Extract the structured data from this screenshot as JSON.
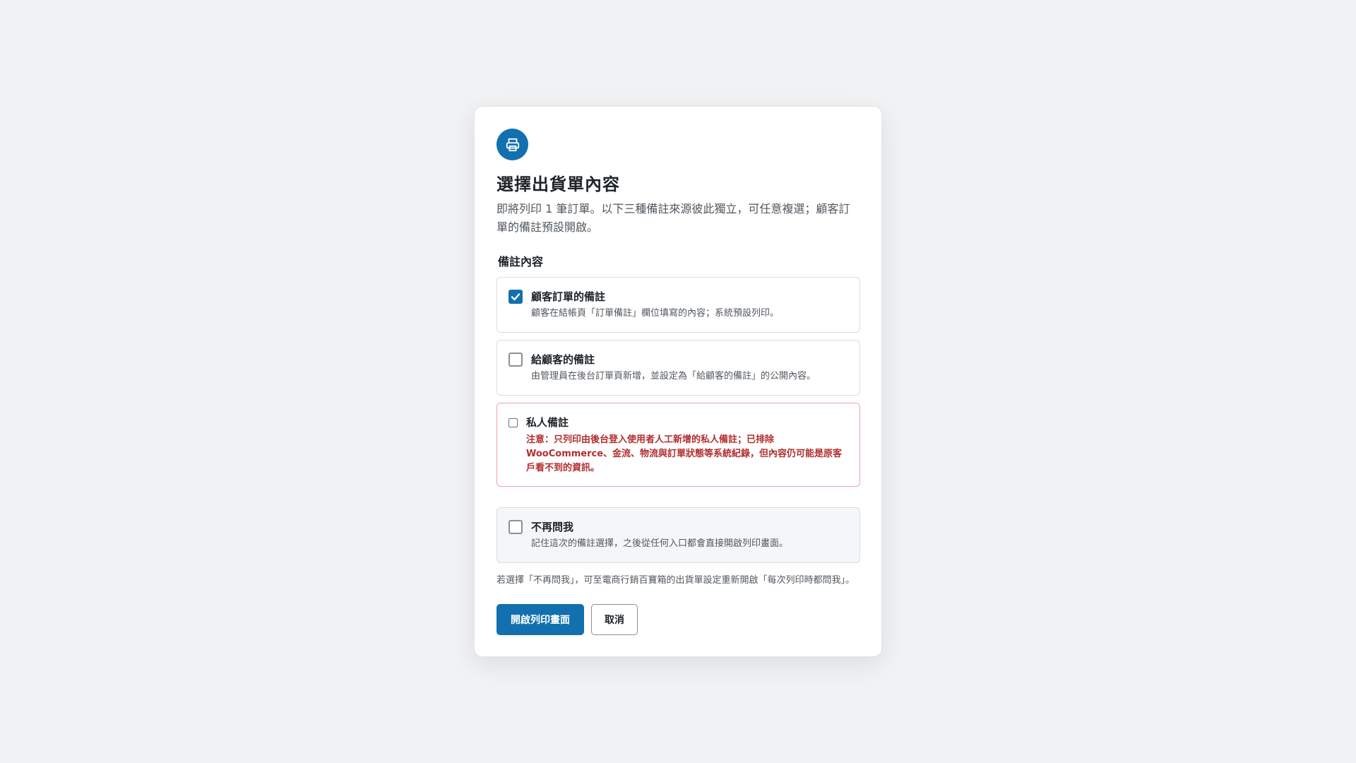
{
  "modal": {
    "icon": "printer-icon",
    "title": "選擇出貨單內容",
    "description": "即將列印 1 筆訂單。以下三種備註來源彼此獨立，可任意複選；顧客訂單的備註預設開啟。",
    "section_label": "備註內容",
    "options": [
      {
        "title": "顧客訂單的備註",
        "subtitle": "顧客在結帳頁「訂單備註」欄位填寫的內容；系統預設列印。",
        "checked": true
      },
      {
        "title": "給顧客的備註",
        "subtitle": "由管理員在後台訂單頁新增，並設定為「給顧客的備註」的公開內容。",
        "checked": false
      },
      {
        "title": "私人備註",
        "warning": "注意：只列印由後台登入使用者人工新增的私人備註；已排除 WooCommerce、金流、物流與訂單狀態等系統紀錄，但內容仍可能是原客戶看不到的資訊。",
        "checked": false
      }
    ],
    "dont_ask": {
      "title": "不再問我",
      "subtitle": "記住這次的備註選擇，之後從任何入口都會直接開啟列印畫面。",
      "checked": false
    },
    "footnote": "若選擇「不再問我」，可至電商行銷百寶箱的出貨單設定重新開啟「每次列印時都問我」。",
    "buttons": {
      "primary": "開啟列印畫面",
      "cancel": "取消"
    }
  },
  "colors": {
    "accent": "#1270ae",
    "warning": "#b32d2e",
    "background": "#f1f2f4"
  }
}
